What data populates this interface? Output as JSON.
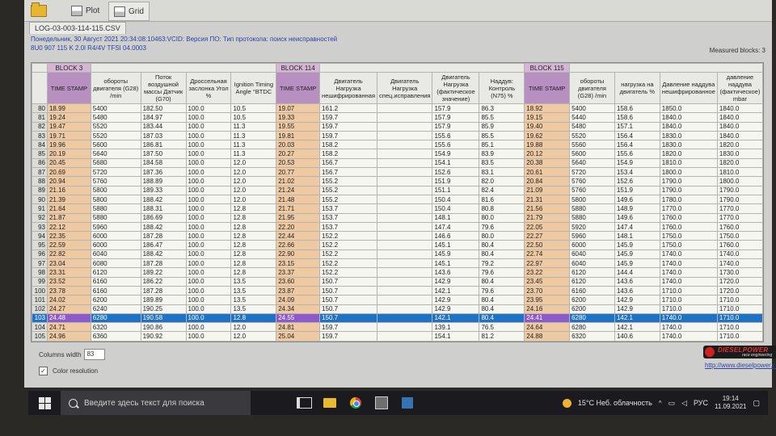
{
  "toolbar": {
    "plot_label": "Plot",
    "grid_label": "Grid"
  },
  "file_tab": "LOG-03-003-114-115.CSV",
  "info_line1": "Понедельник, 30 Август 2021 20:34:08:10463:VCID: Версия ПО: Тип протокола: поиск неисправностей",
  "info_line2": "8U0 907 115 K  2.0l R4/4V TFSI  04.0003",
  "measured_blocks": "Measured blocks: 3",
  "blocks": [
    "BLOCK 3",
    "BLOCK 114",
    "BLOCK 115"
  ],
  "columns": [
    "TIME STAMP",
    "обороты двигателя (G28) /min",
    "Поток воздушной массы Датчик (G70)",
    "Дроссельная заслонка Угол %",
    "Ignition Timing Angle °BTDC",
    "TIME STAMP",
    "Двигатель Нагрузка нешифрированная",
    "Двигатель Нагрузка спец.исправления",
    "Двигатель Нагрузка (фактическое значение)",
    "Наддув: Контроль (N75) %",
    "TIME STAMP",
    "обороты двигателя (G28) /min",
    "нагрузка на двигатель %",
    "Давление наддува нешифрированное",
    "давление наддува (фактическое) mbar"
  ],
  "rows": [
    [
      "80",
      "18.99",
      "5400",
      "182.50",
      "100.0",
      "10.5",
      "19.07",
      "161.2",
      "",
      "157.9",
      "86.3",
      "18.92",
      "5400",
      "158.6",
      "1850.0",
      "1840.0"
    ],
    [
      "81",
      "19.24",
      "5480",
      "184.97",
      "100.0",
      "10.5",
      "19.33",
      "159.7",
      "",
      "157.9",
      "85.5",
      "19.15",
      "5440",
      "158.6",
      "1840.0",
      "1840.0"
    ],
    [
      "82",
      "19.47",
      "5520",
      "183.44",
      "100.0",
      "11.3",
      "19.55",
      "159.7",
      "",
      "157.9",
      "85.9",
      "19.40",
      "5480",
      "157.1",
      "1840.0",
      "1840.0"
    ],
    [
      "83",
      "19.71",
      "5520",
      "187.03",
      "100.0",
      "11.3",
      "19.81",
      "159.7",
      "",
      "155.6",
      "85.5",
      "19.62",
      "5520",
      "156.4",
      "1830.0",
      "1840.0"
    ],
    [
      "84",
      "19.96",
      "5600",
      "186.81",
      "100.0",
      "11.3",
      "20.03",
      "158.2",
      "",
      "155.6",
      "85.1",
      "19.88",
      "5560",
      "156.4",
      "1830.0",
      "1820.0"
    ],
    [
      "85",
      "20.19",
      "5640",
      "187.50",
      "100.0",
      "11.3",
      "20.27",
      "158.2",
      "",
      "154.9",
      "83.9",
      "20.12",
      "5600",
      "155.6",
      "1820.0",
      "1830.0"
    ],
    [
      "86",
      "20.45",
      "5680",
      "184.58",
      "100.0",
      "12.0",
      "20.53",
      "156.7",
      "",
      "154.1",
      "83.5",
      "20.38",
      "5640",
      "154.9",
      "1810.0",
      "1820.0"
    ],
    [
      "87",
      "20.69",
      "5720",
      "187.36",
      "100.0",
      "12.0",
      "20.77",
      "156.7",
      "",
      "152.6",
      "83.1",
      "20.61",
      "5720",
      "153.4",
      "1800.0",
      "1810.0"
    ],
    [
      "88",
      "20.94",
      "5760",
      "188.89",
      "100.0",
      "12.0",
      "21.02",
      "155.2",
      "",
      "151.9",
      "82.0",
      "20.84",
      "5760",
      "152.6",
      "1790.0",
      "1800.0"
    ],
    [
      "89",
      "21.16",
      "5800",
      "189.33",
      "100.0",
      "12.0",
      "21.24",
      "155.2",
      "",
      "151.1",
      "82.4",
      "21.09",
      "5760",
      "151.9",
      "1790.0",
      "1790.0"
    ],
    [
      "90",
      "21.39",
      "5800",
      "188.42",
      "100.0",
      "12.0",
      "21.48",
      "155.2",
      "",
      "150.4",
      "81.6",
      "21.31",
      "5800",
      "149.6",
      "1780.0",
      "1790.0"
    ],
    [
      "91",
      "21.64",
      "5880",
      "188.31",
      "100.0",
      "12.8",
      "21.71",
      "153.7",
      "",
      "150.4",
      "80.8",
      "21.56",
      "5880",
      "148.9",
      "1770.0",
      "1770.0"
    ],
    [
      "92",
      "21.87",
      "5880",
      "186.69",
      "100.0",
      "12.8",
      "21.95",
      "153.7",
      "",
      "148.1",
      "80.0",
      "21.79",
      "5880",
      "149.6",
      "1760.0",
      "1770.0"
    ],
    [
      "93",
      "22.12",
      "5960",
      "188.42",
      "100.0",
      "12.8",
      "22.20",
      "153.7",
      "",
      "147.4",
      "79.6",
      "22.05",
      "5920",
      "147.4",
      "1760.0",
      "1760.0"
    ],
    [
      "94",
      "22.35",
      "6000",
      "187.28",
      "100.0",
      "12.8",
      "22.44",
      "152.2",
      "",
      "146.6",
      "80.0",
      "22.27",
      "5960",
      "148.1",
      "1750.0",
      "1750.0"
    ],
    [
      "95",
      "22.59",
      "6000",
      "186.47",
      "100.0",
      "12.8",
      "22.66",
      "152.2",
      "",
      "145.1",
      "80.4",
      "22.50",
      "6000",
      "145.9",
      "1750.0",
      "1760.0"
    ],
    [
      "96",
      "22.82",
      "6040",
      "188.42",
      "100.0",
      "12.8",
      "22.90",
      "152.2",
      "",
      "145.9",
      "80.4",
      "22.74",
      "6040",
      "145.9",
      "1740.0",
      "1740.0"
    ],
    [
      "97",
      "23.04",
      "6080",
      "187.28",
      "100.0",
      "12.8",
      "23.15",
      "152.2",
      "",
      "145.1",
      "79.2",
      "22.97",
      "6040",
      "145.9",
      "1740.0",
      "1740.0"
    ],
    [
      "98",
      "23.31",
      "6120",
      "189.22",
      "100.0",
      "12.8",
      "23.37",
      "152.2",
      "",
      "143.6",
      "79.6",
      "23.22",
      "6120",
      "144.4",
      "1740.0",
      "1730.0"
    ],
    [
      "99",
      "23.52",
      "6160",
      "186.22",
      "100.0",
      "13.5",
      "23.60",
      "150.7",
      "",
      "142.9",
      "80.4",
      "23.45",
      "6120",
      "143.6",
      "1740.0",
      "1720.0"
    ],
    [
      "100",
      "23.78",
      "6160",
      "187.28",
      "100.0",
      "13.5",
      "23.87",
      "150.7",
      "",
      "142.1",
      "79.6",
      "23.70",
      "6160",
      "143.6",
      "1710.0",
      "1720.0"
    ],
    [
      "101",
      "24.02",
      "6200",
      "189.89",
      "100.0",
      "13.5",
      "24.09",
      "150.7",
      "",
      "142.9",
      "80.4",
      "23.95",
      "6200",
      "142.9",
      "1710.0",
      "1710.0"
    ],
    [
      "102",
      "24.27",
      "6240",
      "190.25",
      "100.0",
      "13.5",
      "24.34",
      "150.7",
      "",
      "142.9",
      "80.4",
      "24.16",
      "6200",
      "142.9",
      "1710.0",
      "1710.0"
    ],
    [
      "103",
      "24.48",
      "6280",
      "190.58",
      "100.0",
      "12.8",
      "24.55",
      "150.7",
      "",
      "142.1",
      "80.4",
      "24.41",
      "6280",
      "142.1",
      "1740.0",
      "1710.0"
    ],
    [
      "104",
      "24.71",
      "6320",
      "190.86",
      "100.0",
      "12.0",
      "24.81",
      "159.7",
      "",
      "139.1",
      "76.5",
      "24.64",
      "6280",
      "142.1",
      "1740.0",
      "1710.0"
    ],
    [
      "105",
      "24.96",
      "6360",
      "190.92",
      "100.0",
      "12.0",
      "25.04",
      "159.7",
      "",
      "154.1",
      "81.2",
      "24.88",
      "6320",
      "140.6",
      "1740.0",
      "1710.0"
    ]
  ],
  "selected_row": "103",
  "columns_width_label": "Columns width",
  "columns_width_value": "83",
  "color_resolution_label": "Color resolution",
  "logo_text": "DIESELPOWER",
  "logo_sub": "race engineering",
  "link": "http://www.dieselpower.cz",
  "taskbar": {
    "search_placeholder": "Введите здесь текст для поиска",
    "weather": "15°C  Неб. облачность",
    "lang": "РУС",
    "time": "19:14",
    "date": "11.09.2021"
  },
  "colors": {
    "selection": "#1f73c6",
    "timestamp_cell": "#efc9a2",
    "block_header": "#d7b5d8"
  }
}
